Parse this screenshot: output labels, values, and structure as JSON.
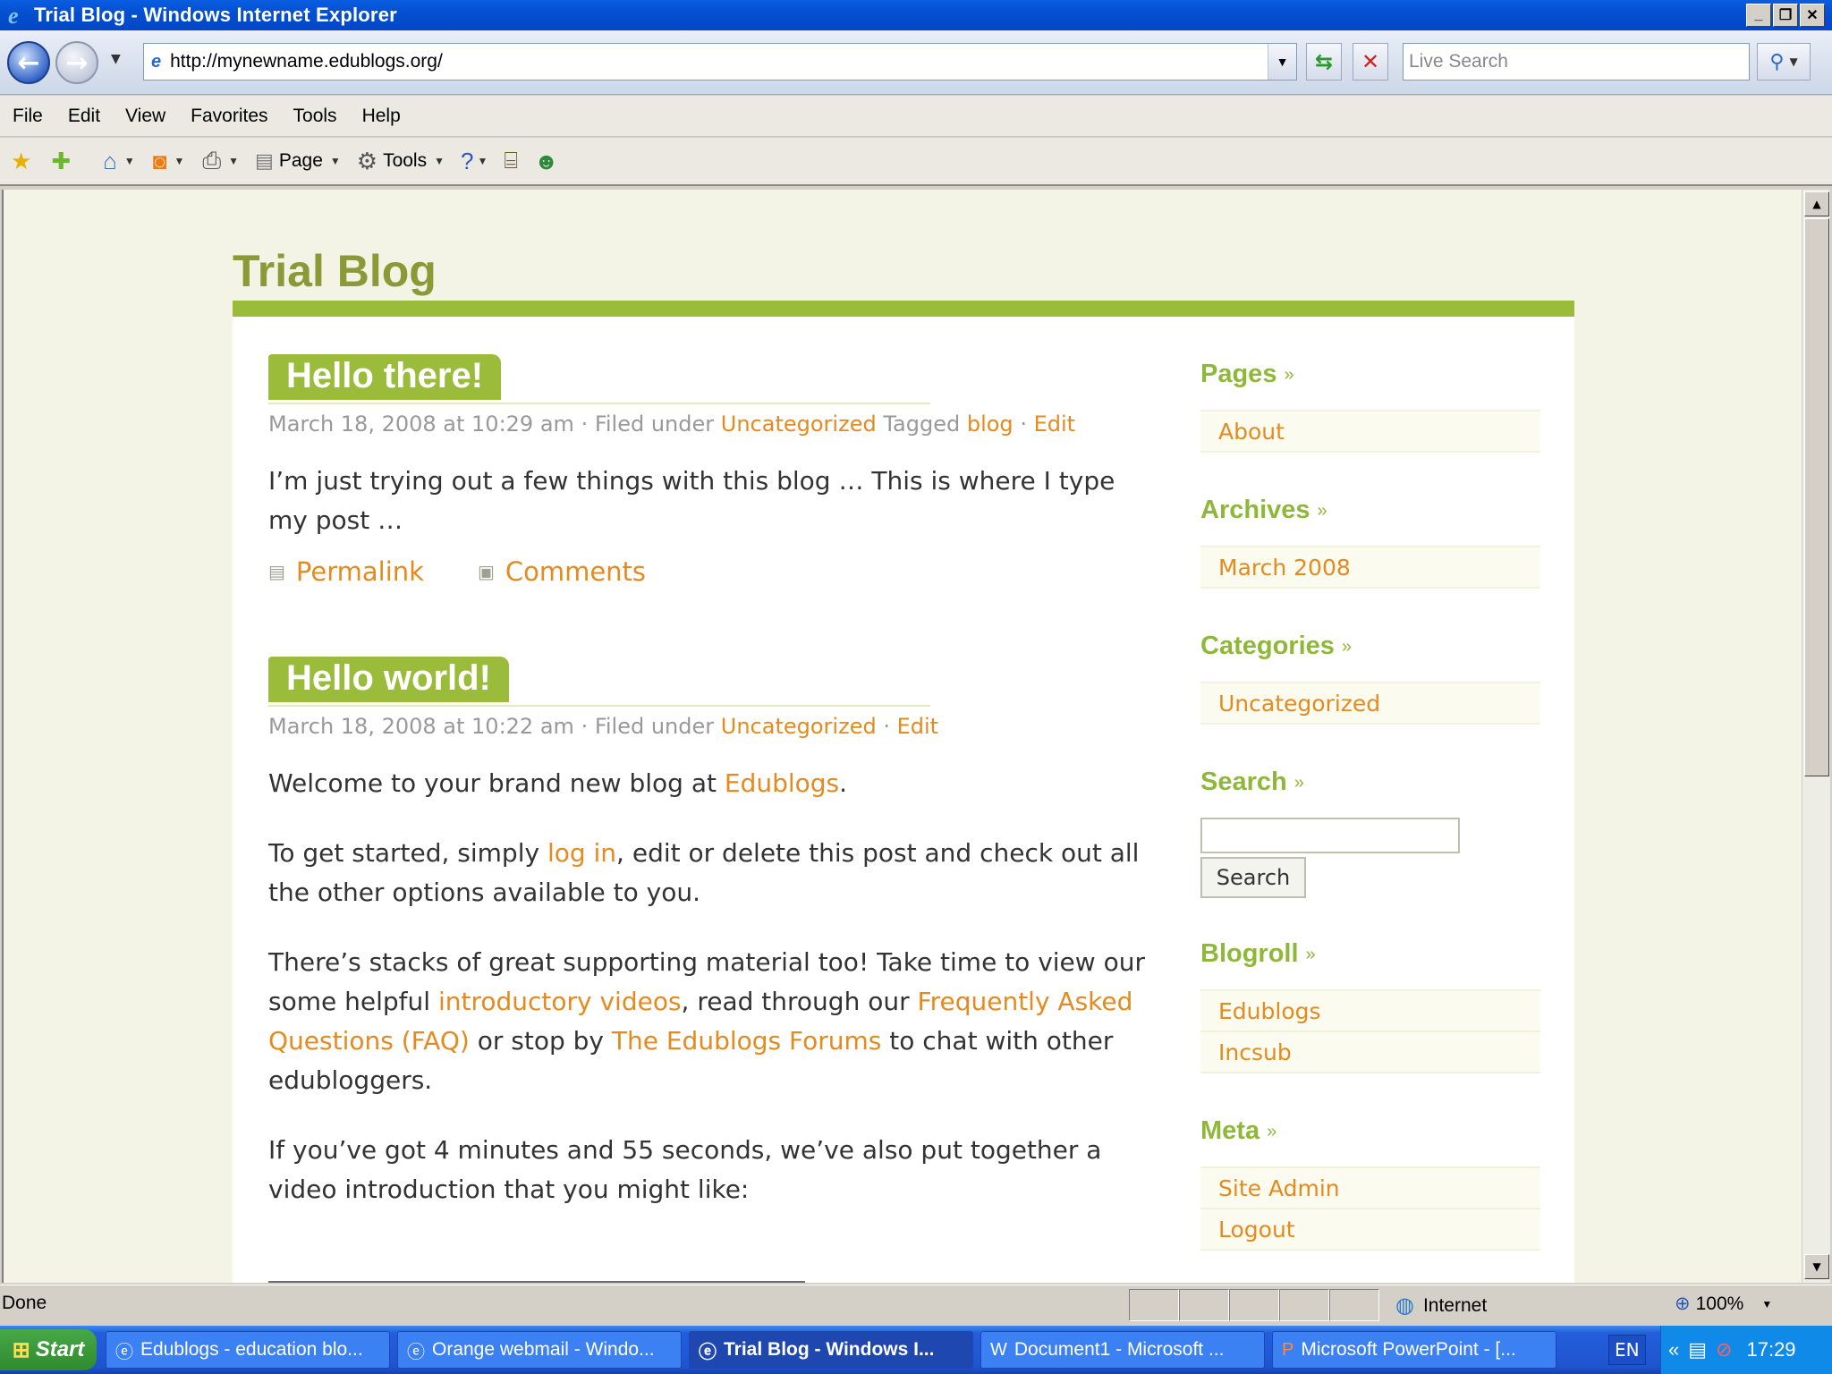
{
  "window": {
    "title": "Trial Blog - Windows Internet Explorer",
    "buttons": [
      "_",
      "❐",
      "✕"
    ]
  },
  "address": {
    "url": "http://mynewname.edublogs.org/",
    "search_placeholder": "Live Search"
  },
  "menu": [
    "File",
    "Edit",
    "View",
    "Favorites",
    "Tools",
    "Help"
  ],
  "commandbar": {
    "page_label": "Page",
    "tools_label": "Tools"
  },
  "blog": {
    "title": "Trial Blog",
    "posts": [
      {
        "title": "Hello there!",
        "date": "March 18, 2008 at 10:29 am",
        "filed_under_label": "· Filed under",
        "category": "Uncategorized",
        "tagged_label": "Tagged",
        "tag": "blog",
        "edit": "Edit",
        "body": "I’m just trying out a few things with this blog … This is where I type my post …",
        "permalink": "Permalink",
        "comments": "Comments"
      },
      {
        "title": "Hello world!",
        "date": "March 18, 2008 at 10:22 am",
        "filed_under_label": "· Filed under",
        "category": "Uncategorized",
        "edit": "Edit",
        "p1_pre": "Welcome to your brand new blog at ",
        "p1_link": "Edublogs",
        "p1_post": ".",
        "p2_pre": "To get started, simply ",
        "p2_link": "log in",
        "p2_post": ", edit or delete this post and check out all the other options available to you.",
        "p3_pre": "There’s stacks of great supporting material too! Take time to view our some helpful ",
        "p3_link1": "introductory videos",
        "p3_mid1": ", read through our ",
        "p3_link2": "Frequently Asked Questions (FAQ)",
        "p3_mid2": " or stop by ",
        "p3_link3": "The Edublogs Forums",
        "p3_post": " to chat with other edubloggers.",
        "p4": "If you’ve got 4 minutes and 55 seconds, we’ve also put together a video introduction that you might like:"
      }
    ]
  },
  "sidebar": {
    "pages_heading": "Pages",
    "pages": [
      "About"
    ],
    "archives_heading": "Archives",
    "archives": [
      "March 2008"
    ],
    "categories_heading": "Categories",
    "categories": [
      "Uncategorized"
    ],
    "search_heading": "Search",
    "search_button": "Search",
    "blogroll_heading": "Blogroll",
    "blogroll": [
      "Edublogs",
      "Incsub"
    ],
    "meta_heading": "Meta",
    "meta": [
      "Site Admin",
      "Logout"
    ],
    "raquo": "»"
  },
  "status": {
    "text": "Done",
    "zone": "Internet",
    "zoom": "100%"
  },
  "taskbar": {
    "start": "Start",
    "tasks": [
      "Edublogs - education blo...",
      "Orange webmail - Windo...",
      "Trial Blog - Windows I...",
      "Document1 - Microsoft ...",
      "Microsoft PowerPoint - [..."
    ],
    "lang": "EN",
    "clock": "17:29"
  },
  "colors": {
    "accent_green": "#9bbb3b",
    "link_orange": "#e58a1e",
    "title_olive": "#8a9a37"
  }
}
